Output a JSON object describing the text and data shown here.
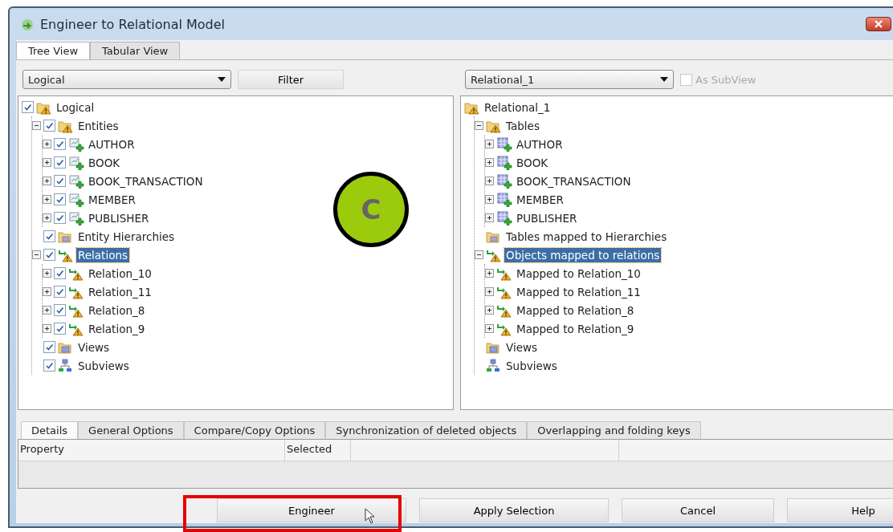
{
  "window": {
    "title": "Engineer to Relational Model"
  },
  "view_tabs": [
    {
      "label": "Tree View",
      "selected": true
    },
    {
      "label": "Tabular View",
      "selected": false
    }
  ],
  "left_panel": {
    "model_select": "Logical",
    "filter_button": "Filter",
    "tree": [
      {
        "label": "Logical",
        "kind": "model",
        "checked": true,
        "selected": false,
        "children": [
          {
            "label": "Entities",
            "kind": "model",
            "checked": true,
            "expanded": true,
            "selected": false,
            "children": [
              {
                "label": "AUTHOR",
                "kind": "entity",
                "checked": true,
                "expanded": false,
                "selected": false
              },
              {
                "label": "BOOK",
                "kind": "entity",
                "checked": true,
                "expanded": false,
                "selected": false
              },
              {
                "label": "BOOK_TRANSACTION",
                "kind": "entity",
                "checked": true,
                "expanded": false,
                "selected": false
              },
              {
                "label": "MEMBER",
                "kind": "entity",
                "checked": true,
                "expanded": false,
                "selected": false
              },
              {
                "label": "PUBLISHER",
                "kind": "entity",
                "checked": true,
                "expanded": false,
                "selected": false
              }
            ]
          },
          {
            "label": "Entity Hierarchies",
            "kind": "hierarchy",
            "checked": true,
            "selected": false
          },
          {
            "label": "Relations",
            "kind": "relation",
            "checked": true,
            "expanded": true,
            "selected": true,
            "children": [
              {
                "label": "Relation_10",
                "kind": "relation",
                "checked": true,
                "expanded": false,
                "selected": false
              },
              {
                "label": "Relation_11",
                "kind": "relation",
                "checked": true,
                "expanded": false,
                "selected": false
              },
              {
                "label": "Relation_8",
                "kind": "relation",
                "checked": true,
                "expanded": false,
                "selected": false
              },
              {
                "label": "Relation_9",
                "kind": "relation",
                "checked": true,
                "expanded": false,
                "selected": false
              }
            ]
          },
          {
            "label": "Views",
            "kind": "views",
            "checked": true,
            "selected": false
          },
          {
            "label": "Subviews",
            "kind": "subviews",
            "checked": true,
            "selected": false
          }
        ]
      }
    ]
  },
  "right_panel": {
    "model_select": "Relational_1",
    "subview_option": {
      "label": "As SubView",
      "checked": false,
      "disabled": true
    },
    "tree": [
      {
        "label": "Relational_1",
        "kind": "model",
        "selected": false,
        "children": [
          {
            "label": "Tables",
            "kind": "model",
            "expanded": true,
            "selected": false,
            "children": [
              {
                "label": "AUTHOR",
                "kind": "table",
                "expanded": false,
                "selected": false
              },
              {
                "label": "BOOK",
                "kind": "table",
                "expanded": false,
                "selected": false
              },
              {
                "label": "BOOK_TRANSACTION",
                "kind": "table",
                "expanded": false,
                "selected": false
              },
              {
                "label": "MEMBER",
                "kind": "table",
                "expanded": false,
                "selected": false
              },
              {
                "label": "PUBLISHER",
                "kind": "table",
                "expanded": false,
                "selected": false
              }
            ]
          },
          {
            "label": "Tables mapped to Hierarchies",
            "kind": "hierarchy",
            "selected": false
          },
          {
            "label": "Objects mapped to relations",
            "kind": "relation",
            "expanded": true,
            "selected": true,
            "children": [
              {
                "label": "Mapped to Relation_10",
                "kind": "relation",
                "expanded": false,
                "selected": false
              },
              {
                "label": "Mapped to Relation_11",
                "kind": "relation",
                "expanded": false,
                "selected": false
              },
              {
                "label": "Mapped to Relation_8",
                "kind": "relation",
                "expanded": false,
                "selected": false
              },
              {
                "label": "Mapped to Relation_9",
                "kind": "relation",
                "expanded": false,
                "selected": false
              }
            ]
          },
          {
            "label": "Views",
            "kind": "views",
            "selected": false
          },
          {
            "label": "Subviews",
            "kind": "subviews",
            "selected": false
          }
        ]
      }
    ]
  },
  "annotation": {
    "label": "C"
  },
  "detail_tabs": [
    {
      "label": "Details",
      "selected": true
    },
    {
      "label": "General Options",
      "selected": false
    },
    {
      "label": "Compare/Copy Options",
      "selected": false
    },
    {
      "label": "Synchronization of deleted objects",
      "selected": false
    },
    {
      "label": "Overlapping and folding keys",
      "selected": false
    }
  ],
  "details_table": {
    "columns": [
      "Property",
      "Selected"
    ]
  },
  "buttons": [
    {
      "label": "Engineer",
      "highlighted": true
    },
    {
      "label": "Apply Selection",
      "highlighted": false
    },
    {
      "label": "Cancel",
      "highlighted": false
    },
    {
      "label": "Help",
      "highlighted": false
    }
  ]
}
